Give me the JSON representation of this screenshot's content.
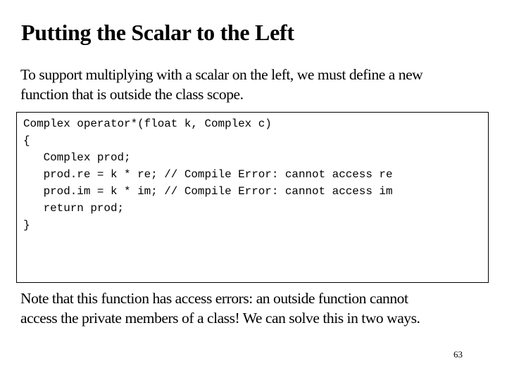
{
  "slide": {
    "title": "Putting the Scalar to the Left",
    "intro_lines": [
      "To support multiplying with a scalar on the left, we must define a new",
      "function that is outside the class scope."
    ],
    "code_lines": [
      "Complex operator*(float k, Complex c)",
      "{",
      "   Complex prod;",
      "   prod.re = k * re; // Compile Error: cannot access re",
      "   prod.im = k * im; // Compile Error: cannot access im",
      "   return prod;",
      "}"
    ],
    "note_lines": [
      "Note that this function has access errors: an outside function cannot",
      "access the private members of a class! We can solve this in two ways."
    ],
    "page_number": "63"
  }
}
